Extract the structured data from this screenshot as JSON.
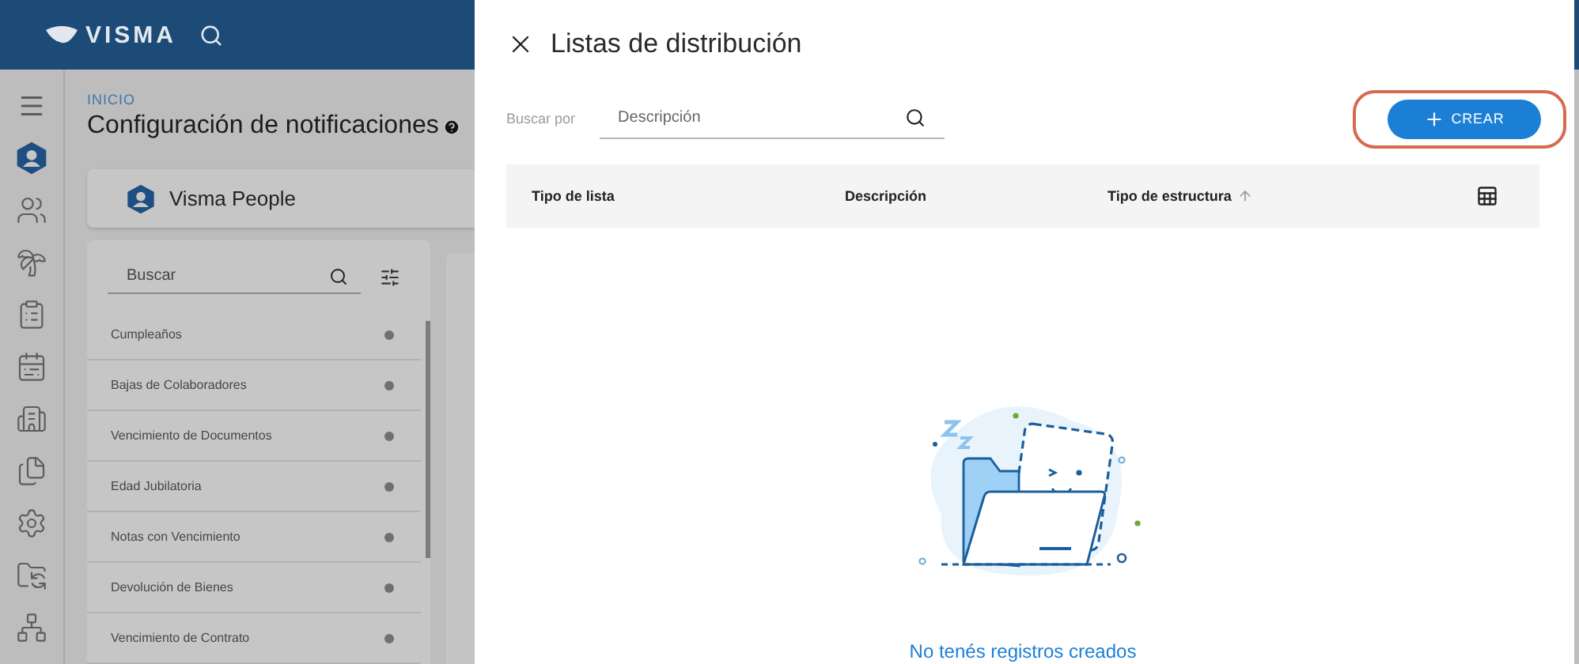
{
  "app": {
    "logo": "VISMA",
    "breadcrumb": "INICIO",
    "title": "Configuración de notificaciones",
    "product": "Visma People",
    "search": {
      "placeholder": "Buscar"
    },
    "notifications": [
      {
        "label": "Cumpleaños"
      },
      {
        "label": "Bajas de Colaboradores"
      },
      {
        "label": "Vencimiento de Documentos"
      },
      {
        "label": "Edad Jubilatoria"
      },
      {
        "label": "Notas con Vencimiento"
      },
      {
        "label": "Devolución de Bienes"
      },
      {
        "label": "Vencimiento de Contrato"
      }
    ]
  },
  "drawer": {
    "title": "Listas de distribución",
    "search_label": "Buscar por",
    "search": {
      "placeholder": "Descripción"
    },
    "create_button": "CREAR",
    "columns": [
      {
        "label": "Tipo de lista",
        "sorted": false
      },
      {
        "label": "Descripción",
        "sorted": false
      },
      {
        "label": "Tipo de estructura",
        "sorted": true
      }
    ],
    "empty_message": "No tenés registros creados"
  }
}
